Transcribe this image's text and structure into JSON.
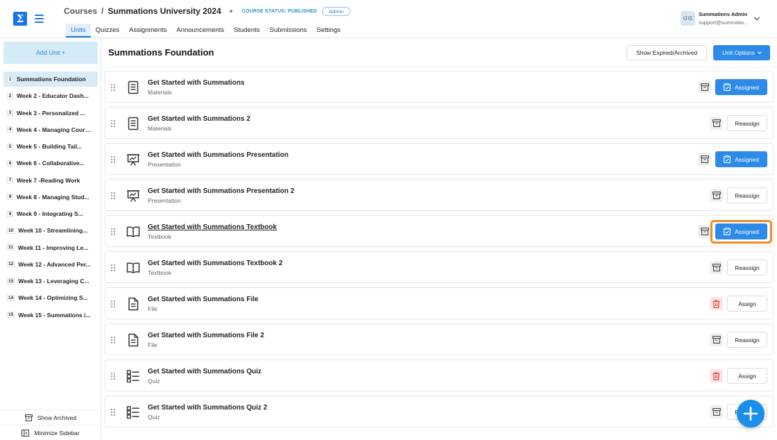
{
  "header": {
    "logo": "Σ",
    "breadcrumb_courses": "Courses",
    "breadcrumb_sep": "/",
    "course_title": "Summations University 2024",
    "course_status": "COURSE STATUS: PUBLISHED",
    "role_badge": "Admin",
    "tabs": [
      {
        "label": "Units",
        "active": true
      },
      {
        "label": "Quizzes"
      },
      {
        "label": "Assignments"
      },
      {
        "label": "Announcements"
      },
      {
        "label": "Students"
      },
      {
        "label": "Submissions"
      },
      {
        "label": "Settings"
      }
    ],
    "user": {
      "avatar": "σα",
      "name": "Summations Admin",
      "email": "support@summatio..."
    }
  },
  "sidebar": {
    "add_unit": "Add Unit +",
    "units": [
      {
        "num": "1",
        "label": "Summations Foundation",
        "active": true
      },
      {
        "num": "2",
        "label": "Week 2 - Educator Dash..."
      },
      {
        "num": "3",
        "label": "Week 3 - Personalized ..."
      },
      {
        "num": "4",
        "label": "Week 4 - Managing Cours..."
      },
      {
        "num": "5",
        "label": "Week 5 - Building Tail..."
      },
      {
        "num": "6",
        "label": "Week 6 - Collaborative..."
      },
      {
        "num": "7",
        "label": "Week 7 -Reading Work"
      },
      {
        "num": "8",
        "label": "Week 8 - Managing Stud..."
      },
      {
        "num": "9",
        "label": "Week 9 - Integrating S..."
      },
      {
        "num": "10",
        "label": "Week 10 - Streamlining..."
      },
      {
        "num": "11",
        "label": "Week 11 - Improving Le..."
      },
      {
        "num": "12",
        "label": "Week 12 - Advanced Per..."
      },
      {
        "num": "13",
        "label": "Week 13 - Leveraging C..."
      },
      {
        "num": "14",
        "label": "Week 14 - Optimizing S..."
      },
      {
        "num": "15",
        "label": "Week 15 - Summations i..."
      }
    ],
    "show_archived": "Show Archived",
    "minimize_sidebar": "Minimize Sidebar"
  },
  "main": {
    "title": "Summations Foundation",
    "show_expired": "Show Expired/Archived",
    "unit_options": "Unit Options",
    "items": [
      {
        "title": "Get Started with Summations",
        "type": "Materials",
        "icon": "document-icon",
        "action": "Assigned",
        "state": "assigned",
        "archive_color": "grey"
      },
      {
        "title": "Get Started with Summations 2",
        "type": "Materials",
        "icon": "document-icon",
        "action": "Reassign",
        "state": "outline",
        "archive_color": "grey"
      },
      {
        "title": "Get Started with Summations Presentation",
        "type": "Presentation",
        "icon": "presentation-icon",
        "action": "Assigned",
        "state": "assigned",
        "archive_color": "grey"
      },
      {
        "title": "Get Started with Summations Presentation 2",
        "type": "Presentation",
        "icon": "presentation-icon",
        "action": "Reassign",
        "state": "outline",
        "archive_color": "grey"
      },
      {
        "title": "Get Started with Summations Textbook",
        "type": "Textbook",
        "icon": "book-icon",
        "action": "Assigned",
        "state": "assigned",
        "archive_color": "grey",
        "highlight": true,
        "underline": true
      },
      {
        "title": "Get Started with Summations Textbook 2",
        "type": "Textbook",
        "icon": "book-icon",
        "action": "Reassign",
        "state": "outline",
        "archive_color": "grey"
      },
      {
        "title": "Get Started with Summations File",
        "type": "File",
        "icon": "file-icon",
        "action": "Assign",
        "state": "outline",
        "archive_color": "red"
      },
      {
        "title": "Get Started with Summations File 2",
        "type": "File",
        "icon": "file-icon",
        "action": "Reassign",
        "state": "outline",
        "archive_color": "grey"
      },
      {
        "title": "Get Started with Summations Quiz",
        "type": "Quiz",
        "icon": "quiz-icon",
        "action": "Assign",
        "state": "outline",
        "archive_color": "red"
      },
      {
        "title": "Get Started with Summations Quiz 2",
        "type": "Quiz",
        "icon": "quiz-icon",
        "action": "Reassign",
        "state": "outline",
        "archive_color": "grey"
      }
    ]
  },
  "colors": {
    "accent": "#2d8ae6",
    "highlight": "#f08a24",
    "sidebar_active": "#d8ebf7"
  }
}
